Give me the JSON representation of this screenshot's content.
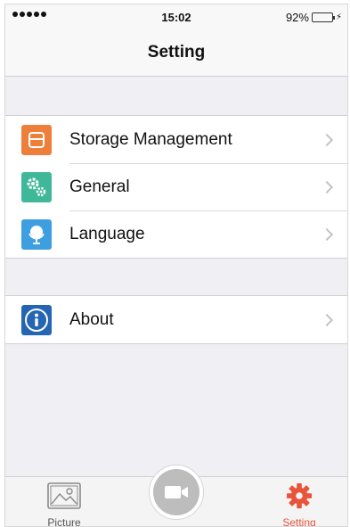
{
  "status_bar": {
    "time": "15:02",
    "battery_percent": "92%",
    "signal_bars": 5
  },
  "header": {
    "title": "Setting"
  },
  "settings_group_1": [
    {
      "label": "Storage Management",
      "icon": "storage-icon",
      "color": "#ee7f3b"
    },
    {
      "label": "General",
      "icon": "gears-icon",
      "color": "#3fb89a"
    },
    {
      "label": "Language",
      "icon": "globe-icon",
      "color": "#3e9fe0"
    }
  ],
  "settings_group_2": [
    {
      "label": "About",
      "icon": "info-icon",
      "color": "#2466b3"
    }
  ],
  "tab_bar": {
    "picture_label": "Picture",
    "setting_label": "Setting",
    "active_color": "#e8543c",
    "record_icon": "video-camera-icon"
  }
}
